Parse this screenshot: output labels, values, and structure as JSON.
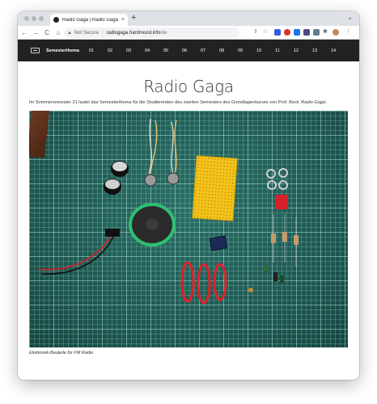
{
  "browser": {
    "tab_title": "Radio Gaga | Radio Gaga",
    "tab_close": "×",
    "new_tab": "+",
    "tab_chevron": "⌄",
    "security_label": "Not Secure",
    "url_domain": "radiogaga.hardmood.info",
    "url_path": "/de",
    "nav_back": "←",
    "nav_forward": "→",
    "nav_reload": "C",
    "nav_home": "⌂",
    "share": "⇪",
    "star": "☆",
    "menu": "⋮"
  },
  "site_nav": {
    "active_label": "Semesterthema",
    "items": [
      "01",
      "02",
      "03",
      "04",
      "05",
      "06",
      "07",
      "08",
      "09",
      "10",
      "11",
      "12",
      "13",
      "14"
    ]
  },
  "main": {
    "title": "Radio Gaga",
    "intro_before": "Im Sommersemester 21 lautet das Semesterthema für die Studierenden des zweiten Semesters des Grundlagenkurses von Prof. Beck '",
    "intro_emphasis": "Radio Gaga",
    "intro_after": "'.",
    "caption": "Elektronik-Bauteile für FM Radio"
  },
  "icons": {
    "back": "arrow-left-icon",
    "forward": "arrow-right-icon",
    "reload": "reload-icon",
    "home": "home-icon",
    "warning": "warning-icon",
    "share": "share-icon",
    "bookmark": "star-icon",
    "extensions": "puzzle-icon",
    "menu": "kebab-menu-icon"
  },
  "colors": {
    "nav_bg": "#222222",
    "mat": "#1f5a53",
    "breadboard": "#f5c21a",
    "speaker_ring": "#2fbf71",
    "wire": "#e0202a"
  }
}
